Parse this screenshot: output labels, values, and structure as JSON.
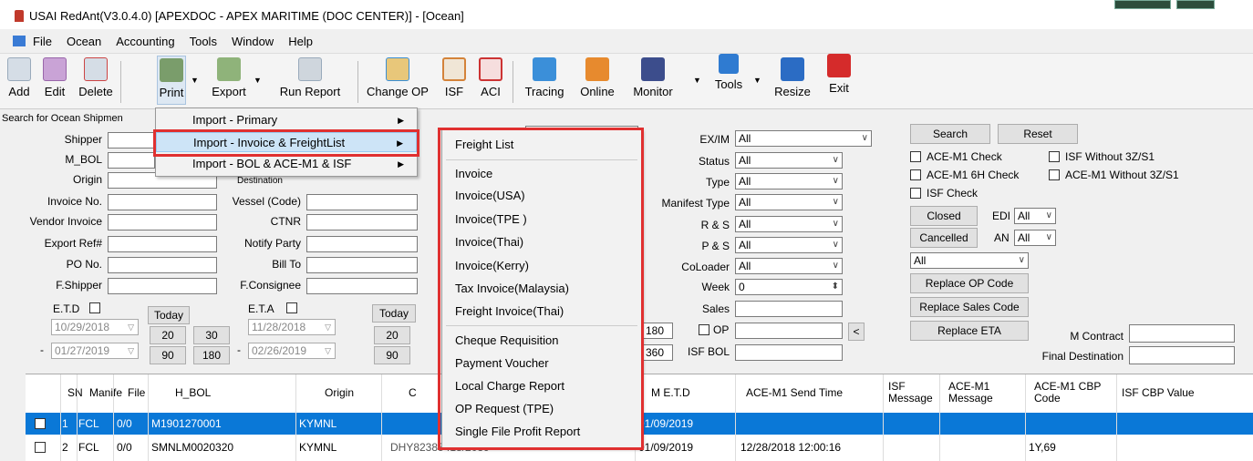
{
  "window": {
    "title": "USAI RedAnt(V3.0.4.0) [APEXDOC - APEX MARITIME (DOC CENTER)] - [Ocean]"
  },
  "menubar": [
    "File",
    "Ocean",
    "Accounting",
    "Tools",
    "Window",
    "Help"
  ],
  "toolbar": {
    "add": "Add",
    "edit": "Edit",
    "delete": "Delete",
    "print": "Print",
    "export": "Export",
    "run_report": "Run Report",
    "change_op": "Change OP",
    "isf": "ISF",
    "aci": "ACI",
    "tracing": "Tracing",
    "online": "Online",
    "monitor": "Monitor",
    "tools": "Tools",
    "resize": "Resize",
    "exit": "Exit"
  },
  "search": {
    "header": "Search for Ocean Shipmen",
    "shipper": "Shipper",
    "m_bol": "M_BOL",
    "origin": "Origin",
    "invoice_no": "Invoice No.",
    "vendor_invoice": "Vendor Invoice",
    "export_ref": "Export Ref#",
    "po_no": "PO No.",
    "f_shipper": "F.Shipper",
    "destination": "Destination",
    "vessel_code": "Vessel (Code)",
    "ctnr": "CTNR",
    "notify_party": "Notify Party",
    "bill_to": "Bill To",
    "f_consignee": "F.Consignee",
    "etd": "E.T.D",
    "eta": "E.T.A",
    "today": "Today",
    "etd_from": "10/29/2018",
    "etd_to": "01/27/2019",
    "eta_from": "11/28/2018",
    "eta_to": "02/26/2019",
    "dash": "-",
    "n20": "20",
    "n30": "30",
    "n90": "90",
    "n180": "180"
  },
  "filters": {
    "exim": "EX/IM",
    "status": "Status",
    "type": "Type",
    "manifest_type": "Manifest Type",
    "rs": "R & S",
    "ps": "P & S",
    "coloader": "CoLoader",
    "week": "Week",
    "sales": "Sales",
    "op": "OP",
    "isf_bol": "ISF BOL",
    "all": "All",
    "week_value": "0",
    "n180": "180",
    "n360": "360",
    "lt": "<"
  },
  "right": {
    "search": "Search",
    "reset": "Reset",
    "ace_m1_check": "ACE-M1 Check",
    "isf_without": "ISF Without 3Z/S1",
    "ace_m1_6h": "ACE-M1 6H Check",
    "ace_m1_without": "ACE-M1 Without 3Z/S1",
    "isf_check": "ISF Check",
    "closed": "Closed",
    "edi": "EDI",
    "cancelled": "Cancelled",
    "an": "AN",
    "all": "All",
    "replace_op": "Replace OP Code",
    "replace_sales": "Replace Sales Code",
    "replace_eta": "Replace ETA",
    "m_contract": "M Contract",
    "final_destination": "Final Destination"
  },
  "grid": {
    "headers": [
      "SN",
      "Manife",
      "File",
      "H_BOL",
      "Origin",
      "C",
      "M E.T.D",
      "ACE-M1 Send Time",
      "ISF Message",
      "ACE-M1 Message",
      "ACE-M1 CBP Code",
      "ISF CBP Value"
    ],
    "rows": [
      {
        "sn": "1",
        "manifest": "FCL",
        "file": "0/0",
        "hbol": "M1901270001",
        "origin": "KYMNL",
        "c": "",
        "metd": "01/09/2019",
        "send": "",
        "code": ""
      },
      {
        "sn": "2",
        "manifest": "FCL",
        "file": "0/0",
        "hbol": "SMNLM0020320",
        "origin": "KYMNL",
        "c": "DHY82385418/2039",
        "metd": "01/09/2019",
        "send": "12/28/2018 12:00:16",
        "code": "1Y,69"
      }
    ]
  },
  "print_menu": [
    "Import - Primary",
    "Import - Invoice & FreightList",
    "Import - BOL & ACE-M1 & ISF"
  ],
  "submenu": [
    "Freight List",
    "Invoice",
    "Invoice(USA)",
    "Invoice(TPE )",
    "Invoice(Thai)",
    "Invoice(Kerry)",
    "Tax Invoice(Malaysia)",
    "Freight Invoice(Thai)",
    "Cheque Requisition",
    "Payment Voucher",
    "Local Charge Report",
    "OP Request (TPE)",
    "Single File Profit Report"
  ]
}
